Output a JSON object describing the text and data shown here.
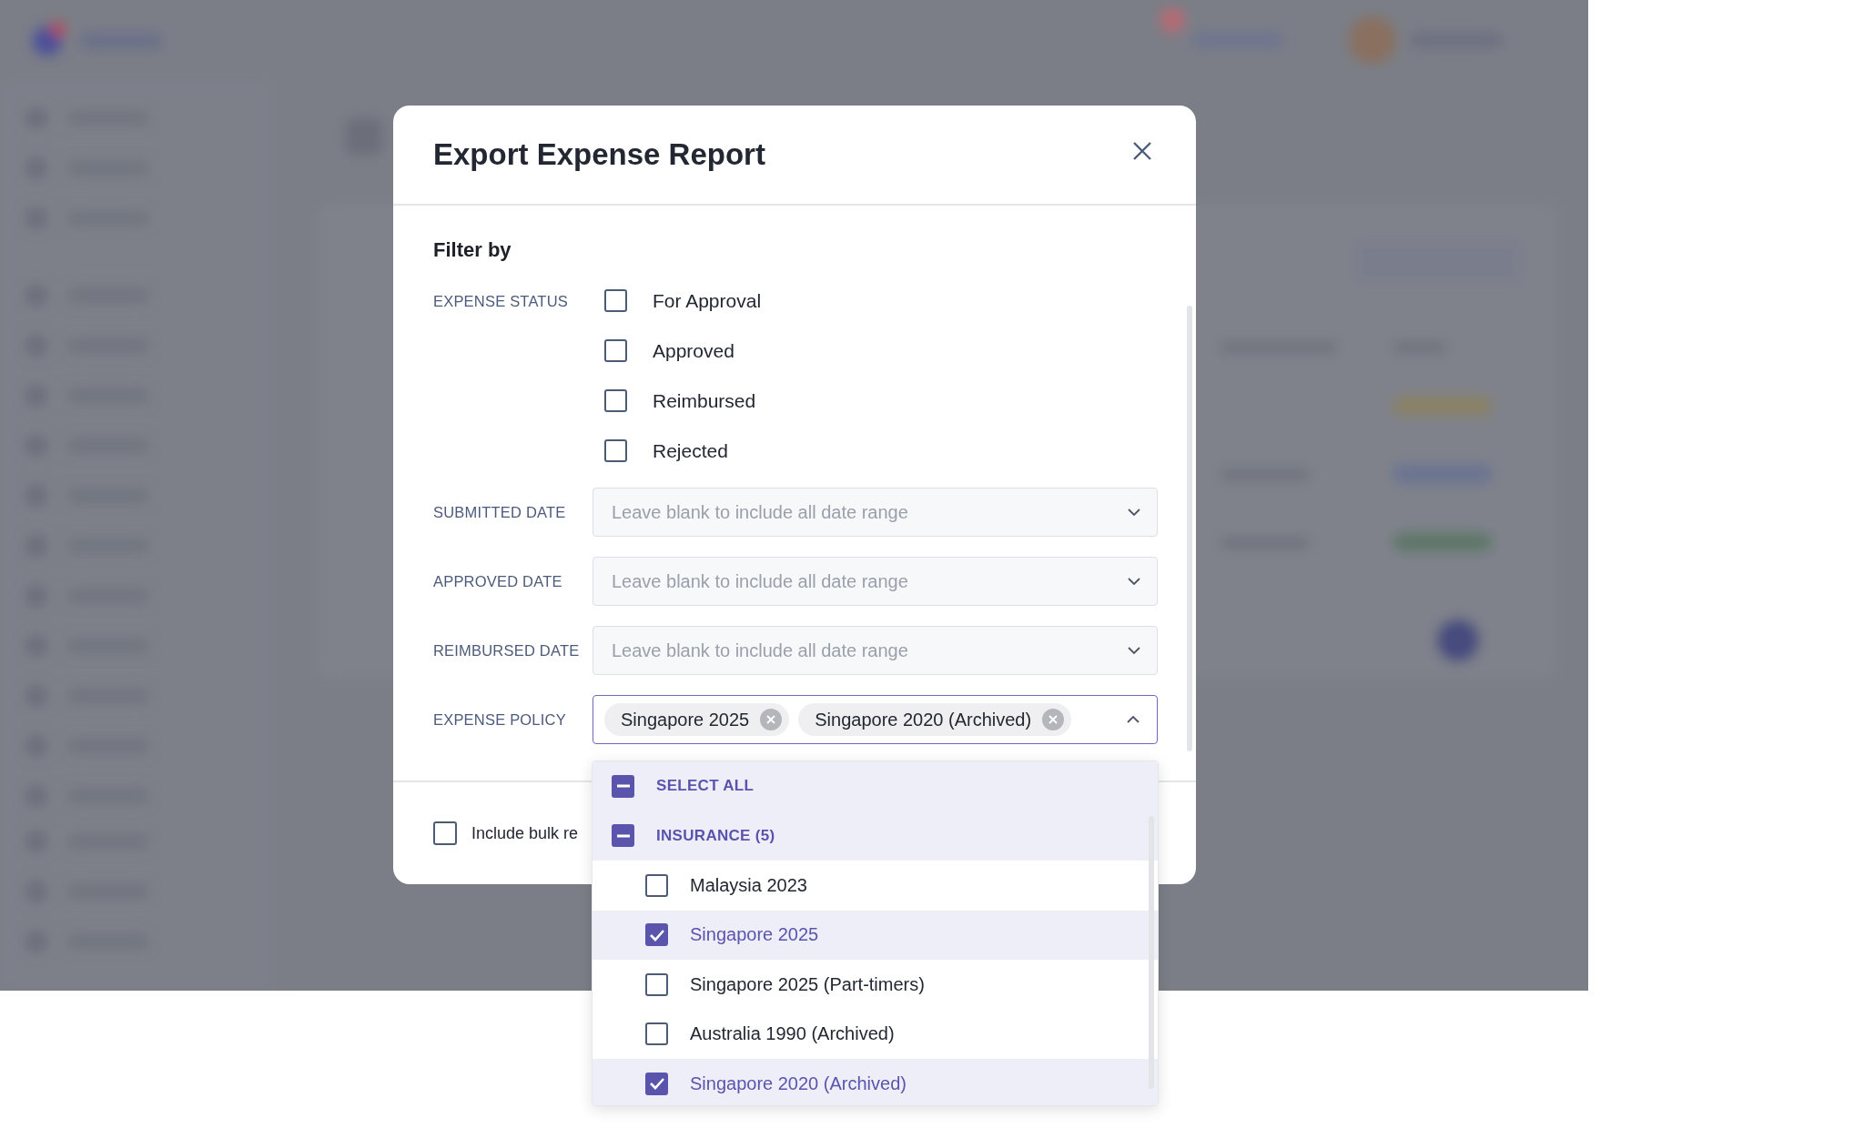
{
  "dialog": {
    "title": "Export Expense Report",
    "section_title": "Filter by"
  },
  "expense_status": {
    "label": "EXPENSE STATUS",
    "options": [
      {
        "label": "For Approval",
        "checked": false
      },
      {
        "label": "Approved",
        "checked": false
      },
      {
        "label": "Reimbursed",
        "checked": false
      },
      {
        "label": "Rejected",
        "checked": false
      }
    ]
  },
  "date_filters": [
    {
      "label": "SUBMITTED DATE",
      "placeholder": "Leave blank to include all date range"
    },
    {
      "label": "APPROVED DATE",
      "placeholder": "Leave blank to include all date range"
    },
    {
      "label": "REIMBURSED DATE",
      "placeholder": "Leave blank to include all date range"
    }
  ],
  "expense_policy": {
    "label": "EXPENSE POLICY",
    "expanded": true,
    "chips": [
      "Singapore 2025",
      "Singapore 2020 (Archived)"
    ],
    "options": [
      {
        "kind": "group",
        "label": "SELECT ALL",
        "indeterminate": true
      },
      {
        "kind": "group",
        "label": "INSURANCE (5)",
        "indeterminate": true
      },
      {
        "kind": "item",
        "label": "Malaysia 2023",
        "checked": false
      },
      {
        "kind": "item",
        "label": "Singapore 2025",
        "checked": true
      },
      {
        "kind": "item",
        "label": "Singapore 2025 (Part-timers)",
        "checked": false
      },
      {
        "kind": "item",
        "label": "Australia 1990 (Archived)",
        "checked": false
      },
      {
        "kind": "item",
        "label": "Singapore 2020 (Archived)",
        "checked": true
      }
    ]
  },
  "footer": {
    "checkbox": {
      "label": "Include bulk re",
      "checked": false
    }
  }
}
